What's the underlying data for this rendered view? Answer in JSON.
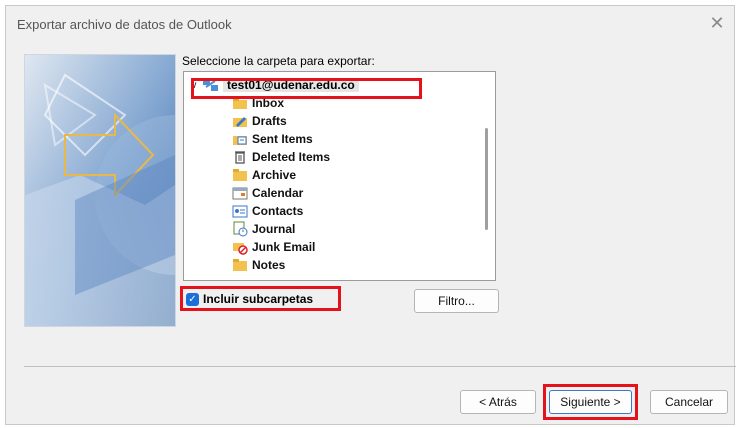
{
  "window": {
    "title": "Exportar archivo de datos de Outlook",
    "close_glyph": "✕"
  },
  "prompt": "Seleccione la carpeta para exportar:",
  "tree": {
    "account": "test01@udenar.edu.co",
    "expand_glyph": "∨",
    "folders": [
      {
        "label": "Inbox",
        "icon": "inbox-icon"
      },
      {
        "label": "Drafts",
        "icon": "drafts-icon"
      },
      {
        "label": "Sent Items",
        "icon": "sent-items-icon"
      },
      {
        "label": "Deleted Items",
        "icon": "deleted-items-icon"
      },
      {
        "label": "Archive",
        "icon": "archive-folder-icon"
      },
      {
        "label": "Calendar",
        "icon": "calendar-icon"
      },
      {
        "label": "Contacts",
        "icon": "contacts-icon"
      },
      {
        "label": "Journal",
        "icon": "journal-icon"
      },
      {
        "label": "Junk Email",
        "icon": "junk-email-icon"
      },
      {
        "label": "Notes",
        "icon": "notes-icon"
      }
    ]
  },
  "include_subfolders": {
    "label": "Incluir subcarpetas",
    "checked": true
  },
  "buttons": {
    "filter": "Filtro...",
    "back": "< Atrás",
    "next": "Siguiente >",
    "cancel": "Cancelar"
  },
  "colors": {
    "highlight_red": "#e3121b",
    "checkbox_blue": "#1a6fd8",
    "folder_yellow": "#f2c14e"
  }
}
